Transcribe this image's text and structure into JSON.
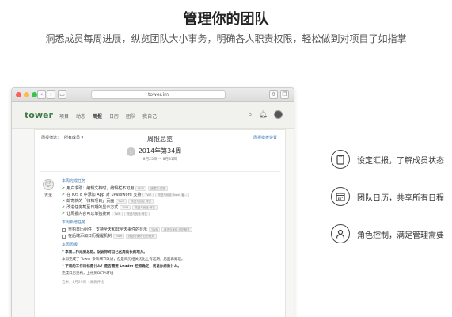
{
  "hero": {
    "title": "管理你的团队",
    "subtitle": "洞悉成员每周进展，纵览团队大小事务，明确各人职责权限，轻松做到对项目了如指掌"
  },
  "browser": {
    "url": "tower.im"
  },
  "app": {
    "logo": "tower",
    "nav": [
      "项目",
      "动态",
      "周报",
      "日历",
      "团队",
      "我自己"
    ],
    "active_nav": "周报",
    "icons": [
      "search-icon",
      "bell-icon",
      "avatar"
    ]
  },
  "report": {
    "filter_label": "周报筛选：",
    "filter_value": "所有成员 ▾",
    "settings_link": "周报模板设置",
    "title": "周报总览",
    "week": "2014年第34周",
    "range": "8月25日 ～ 8月31日",
    "member_name": "吉米",
    "sections": {
      "done_title": "本周完成任务",
      "done_items": [
        {
          "text": "用户求助：编辑文档时，编辑栏不可用",
          "tags": [
            "MOK",
            "团建站·客服"
          ]
        },
        {
          "text": "在 iOS 8 中添加 App 对 1Password 支持",
          "tags": [
            "TWR",
            "改进与优化·Tower 客..."
          ]
        },
        {
          "text": "邮寄新的「归档项目」页面",
          "tags": [
            "TWR",
            "改进与优化·其它"
          ]
        },
        {
          "text": "改进任务截至日期的显示方式",
          "tags": [
            "TWR",
            "改进与优化·其它"
          ]
        },
        {
          "text": "让周报内容可以单独搜索",
          "tags": [
            "TWR",
            "改进与优化·其它"
          ]
        }
      ],
      "todo_title": "本周新增任务",
      "todo_items": [
        {
          "text": "重构日历组件，支持全天和非全天事件的显示",
          "tags": [
            "TWR",
            "改进与优化·日历相关"
          ]
        },
        {
          "text": "在后端添加日历提醒机制",
          "tags": [
            "TWR",
            "改进与优化·日历相关"
          ]
        }
      ],
      "weekly_title": "本周周报",
      "weekly_lines": [
        {
          "text": "❝ 本周工作成果总结。说说你对自己这周成长的地方。",
          "bold": true
        },
        {
          "text": "本周完成了 Tower 多项细节改进，但是日历相关优化上有延期，后面再处理。",
          "bold": false
        },
        {
          "text": "❝ 下周的工作目标是什么？是否需要 Leader 还原确定，说说你想做什么。",
          "bold": true
        },
        {
          "text": "完成日历重构，上线到BETA环境",
          "bold": false
        }
      ],
      "meta": "吉米，8月29日 · 发表评论"
    }
  },
  "features": [
    {
      "icon": "clipboard-icon",
      "label": "设定汇报，了解成员状态"
    },
    {
      "icon": "calendar-icon",
      "label": "团队日历，共享所有日程"
    },
    {
      "icon": "user-role-icon",
      "label": "角色控制，满足管理需要"
    }
  ]
}
